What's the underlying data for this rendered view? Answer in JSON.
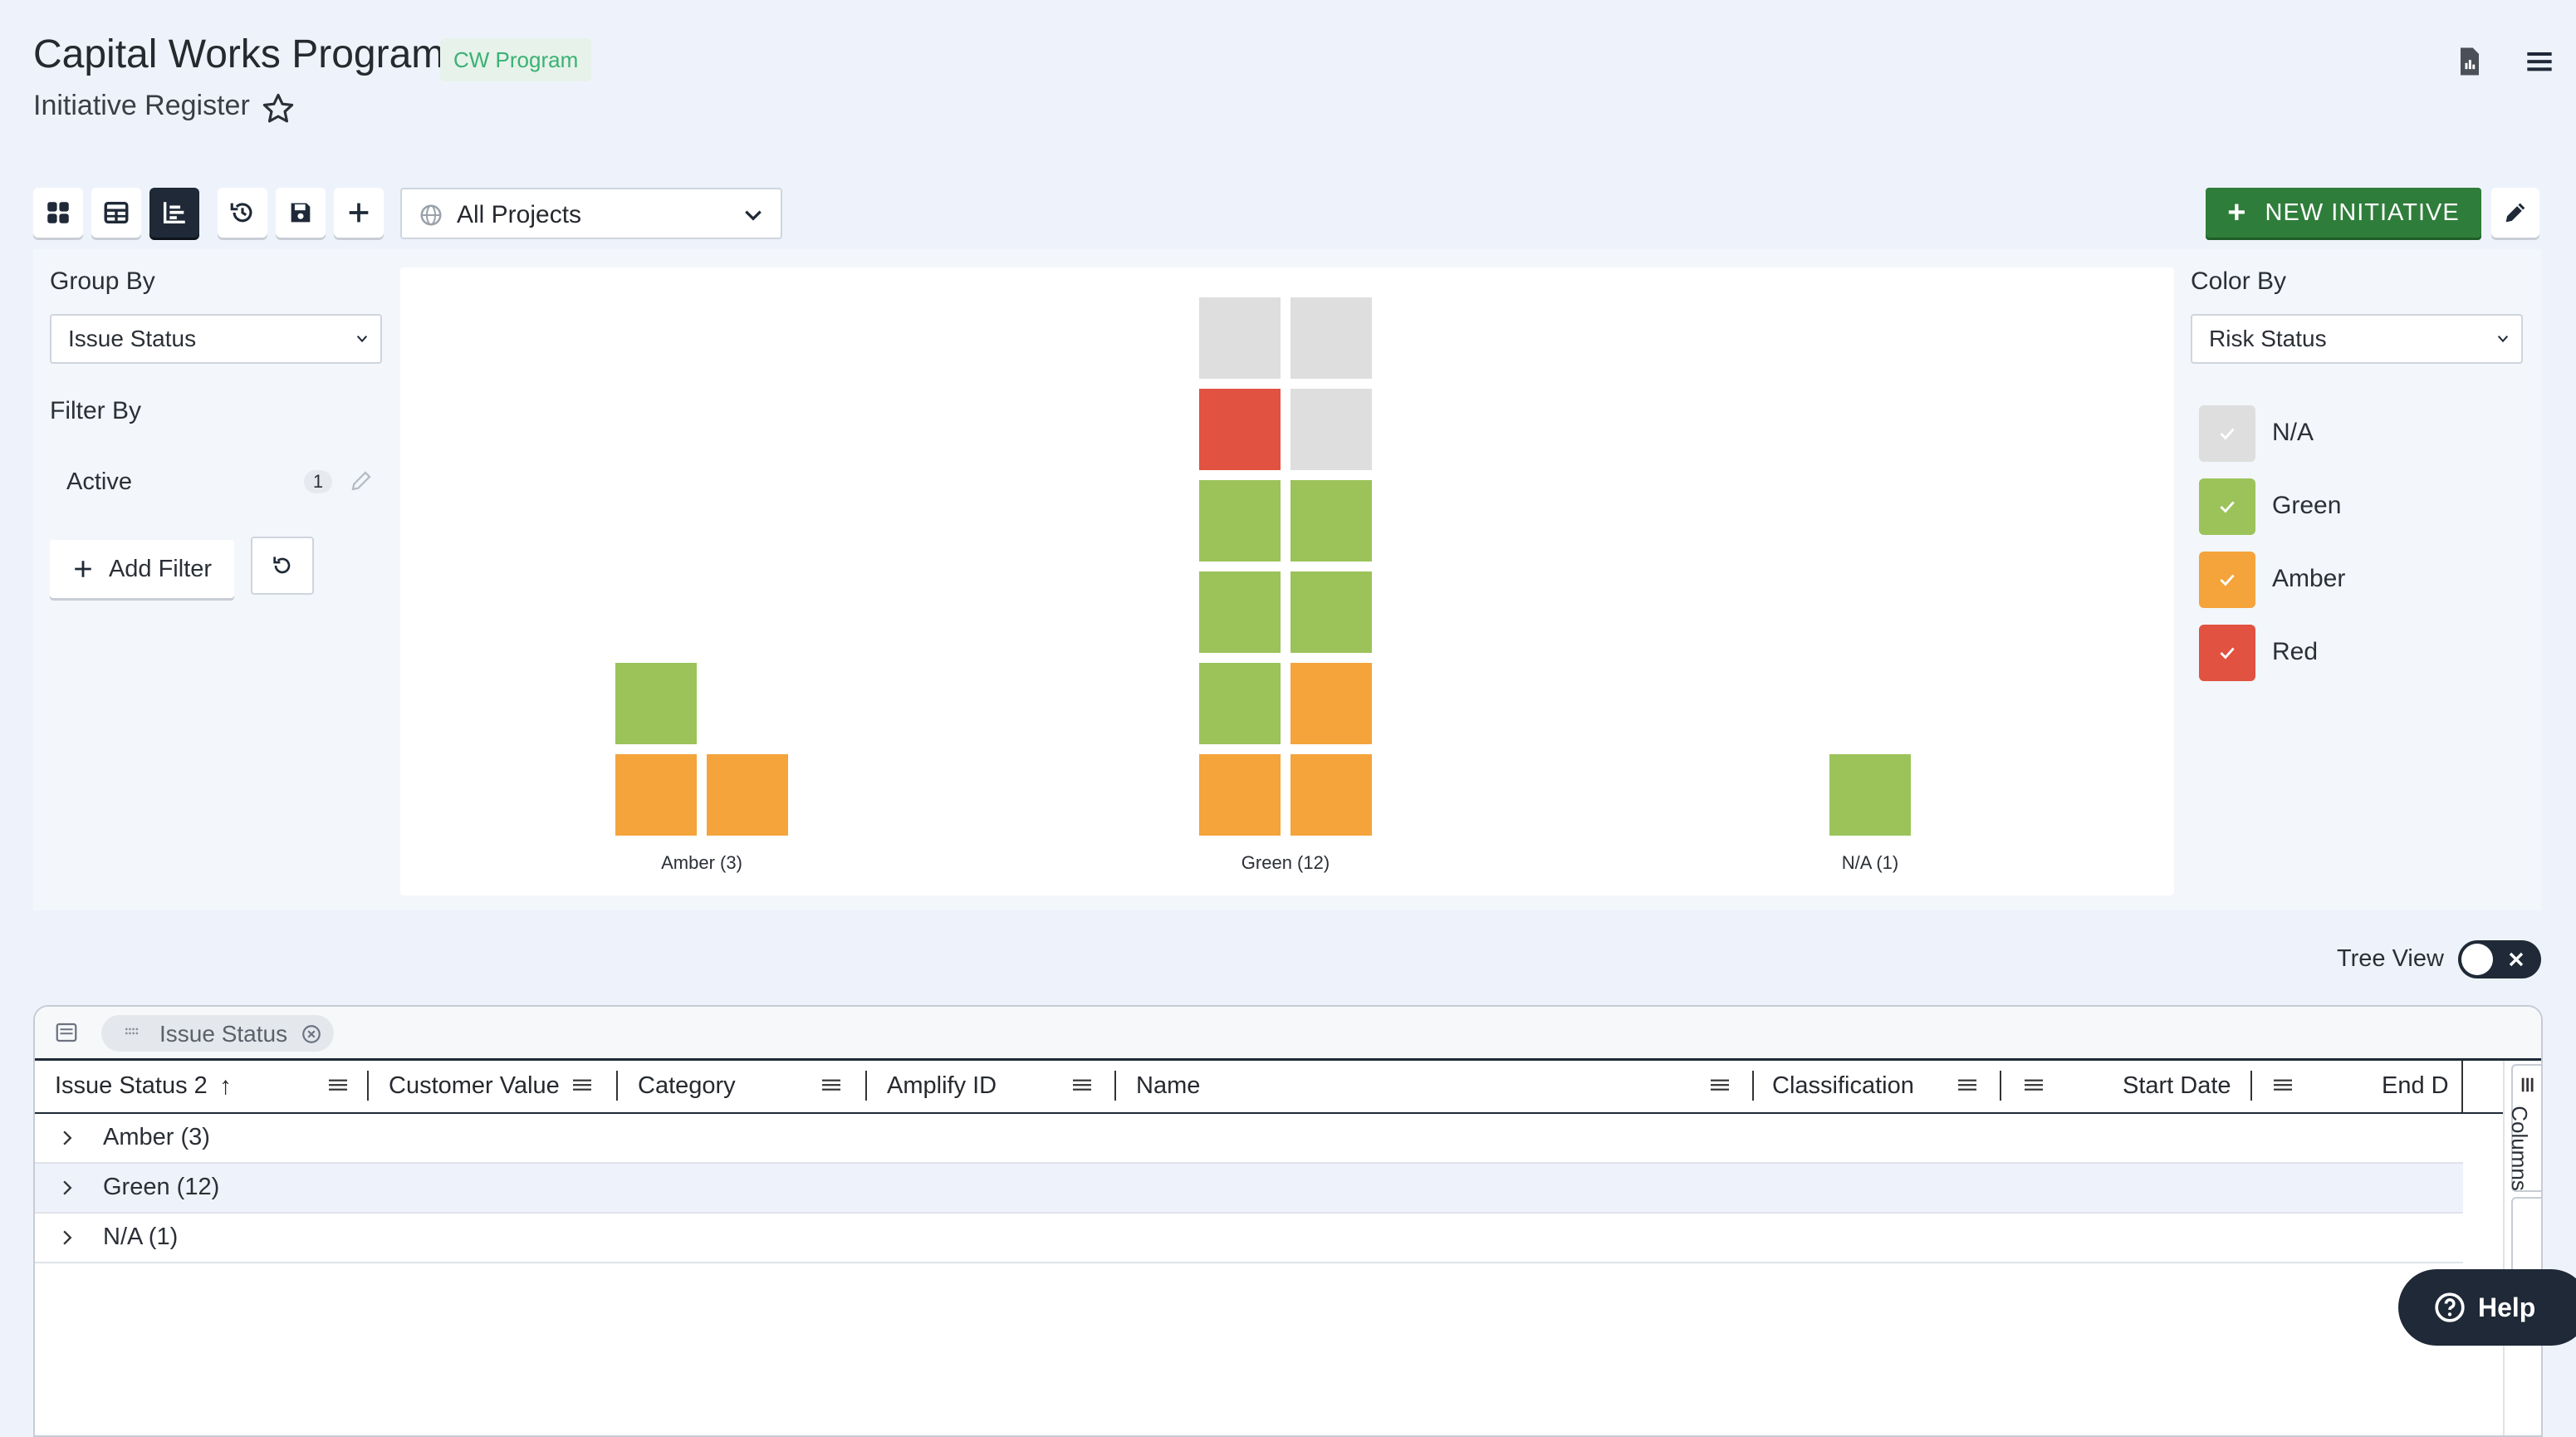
{
  "header": {
    "title": "Capital Works Program",
    "badge": "CW Program",
    "subtitle": "Initiative Register"
  },
  "toolbar": {
    "project_select": "All Projects",
    "new_button": "NEW INITIATIVE"
  },
  "left_panel": {
    "group_by_label": "Group By",
    "group_by_value": "Issue Status",
    "filter_by_label": "Filter By",
    "filter_name": "Active",
    "filter_count": "1",
    "add_filter": "Add Filter"
  },
  "right_panel": {
    "color_by_label": "Color By",
    "color_by_value": "Risk Status",
    "legend": [
      {
        "label": "N/A",
        "color": "#dedede"
      },
      {
        "label": "Green",
        "color": "#9bc35a"
      },
      {
        "label": "Amber",
        "color": "#f4a43b"
      },
      {
        "label": "Red",
        "color": "#e15241"
      }
    ]
  },
  "chart_data": {
    "type": "waffle",
    "categories": [
      "Amber (3)",
      "Green (12)",
      "N/A (1)"
    ],
    "groups": [
      {
        "label": "Amber (3)",
        "items": [
          "Amber",
          "Amber",
          "Green"
        ]
      },
      {
        "label": "Green (12)",
        "items": [
          "Amber",
          "Amber",
          "Green",
          "Amber",
          "Green",
          "Green",
          "Green",
          "Green",
          "Red",
          "N/A",
          "N/A",
          "N/A"
        ]
      },
      {
        "label": "N/A (1)",
        "items": [
          "Green"
        ]
      }
    ]
  },
  "tree_view": {
    "label": "Tree View"
  },
  "grid": {
    "group_chip": "Issue Status",
    "columns": [
      "Issue Status 2",
      "Customer Value",
      "Category",
      "Amplify ID",
      "Name",
      "Classification",
      "Start Date",
      "End D"
    ],
    "rows": [
      "Amber (3)",
      "Green (12)",
      "N/A (1)"
    ],
    "columns_tab": "Columns"
  },
  "help": {
    "label": "Help"
  }
}
